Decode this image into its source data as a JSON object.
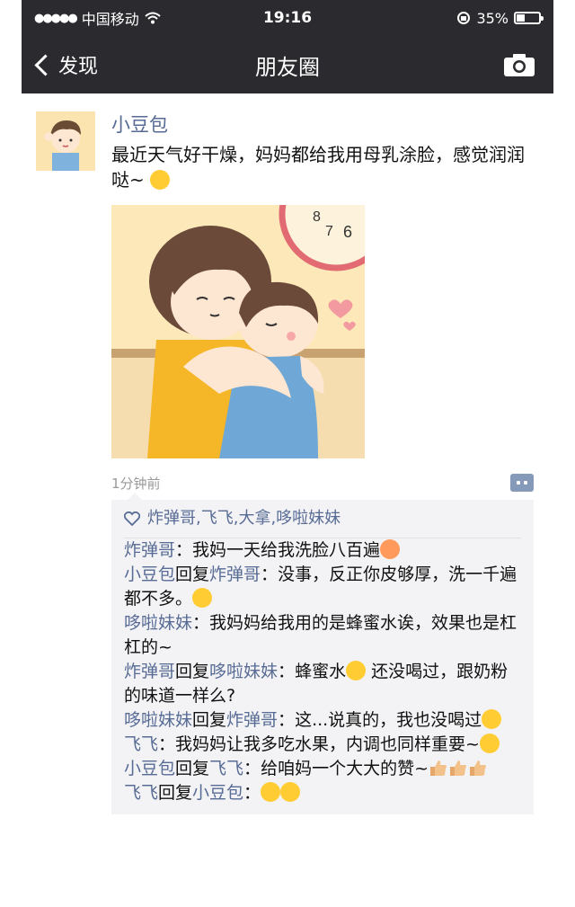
{
  "status": {
    "carrier": "中国移动",
    "time": "19:16",
    "battery": "35%",
    "battery_level": 0.35
  },
  "nav": {
    "back_label": "发现",
    "title": "朋友圈"
  },
  "post": {
    "username": "小豆包",
    "text": "最近天气好干燥，妈妈都给我用母乳涂脸，感觉润润哒~",
    "time_ago": "1分钟前",
    "photo_clock_digits": [
      "8",
      "7",
      "6"
    ]
  },
  "likes": "炸弹哥,飞飞,大拿,哆啦妹妹",
  "comments": [
    {
      "from": "炸弹哥",
      "to": "",
      "sep": "：",
      "text": "我妈一天给我洗脸八百遍",
      "emoji": [
        "crying"
      ]
    },
    {
      "from": "小豆包",
      "to": "炸弹哥",
      "sep": "：",
      "text": "没事，反正你皮够厚，洗一千遍都不多。",
      "emoji": [
        "smile"
      ]
    },
    {
      "from": "哆啦妹妹",
      "to": "",
      "sep": "：",
      "text": "我妈妈给我用的是蜂蜜水诶，效果也是杠杠的~",
      "emoji": []
    },
    {
      "from": "炸弹哥",
      "to": "哆啦妹妹",
      "sep": "：",
      "text": "蜂蜜水",
      "emoji": [
        "heart-eyes"
      ],
      "text2": "还没喝过，跟奶粉的味道一样么?"
    },
    {
      "from": "哆啦妹妹",
      "to": "炸弹哥",
      "sep": "：",
      "text": "这...说真的，我也没喝过",
      "emoji": [
        "sad"
      ]
    },
    {
      "from": "飞飞",
      "to": "",
      "sep": "：",
      "text": "我妈妈让我多吃水果，内调也同样重要~",
      "emoji": [
        "smirk"
      ]
    },
    {
      "from": "小豆包",
      "to": "飞飞",
      "sep": "：",
      "text": "给咱妈一个大大的赞~",
      "emoji": [
        "thumbs-up",
        "thumbs-up",
        "thumbs-up"
      ]
    },
    {
      "from": "飞飞",
      "to": "小豆包",
      "sep": "：",
      "text": "",
      "emoji": [
        "smile",
        "smile"
      ]
    }
  ],
  "reply_word": "回复",
  "colors": {
    "header_bg": "#2b2b2f",
    "name_link": "#576b95",
    "comment_bg": "#f3f3f5"
  }
}
